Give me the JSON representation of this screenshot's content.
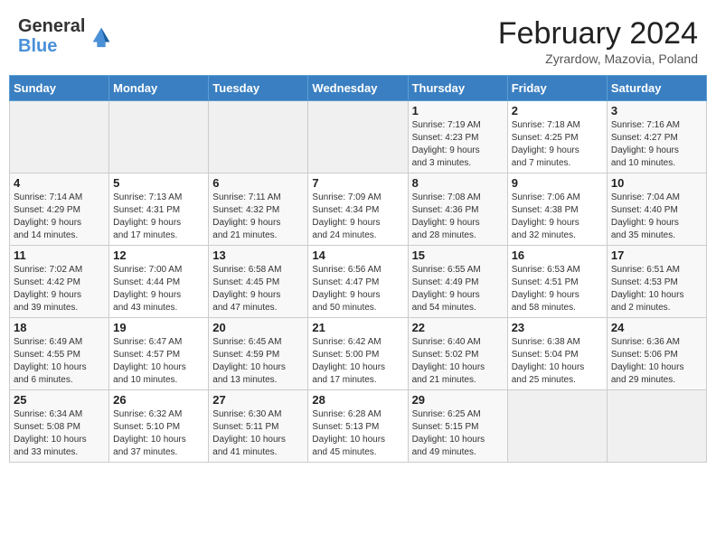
{
  "logo": {
    "general": "General",
    "blue": "Blue"
  },
  "title": {
    "month_year": "February 2024",
    "location": "Zyrardow, Mazovia, Poland"
  },
  "weekdays": [
    "Sunday",
    "Monday",
    "Tuesday",
    "Wednesday",
    "Thursday",
    "Friday",
    "Saturday"
  ],
  "weeks": [
    [
      {
        "day": "",
        "info": ""
      },
      {
        "day": "",
        "info": ""
      },
      {
        "day": "",
        "info": ""
      },
      {
        "day": "",
        "info": ""
      },
      {
        "day": "1",
        "info": "Sunrise: 7:19 AM\nSunset: 4:23 PM\nDaylight: 9 hours\nand 3 minutes."
      },
      {
        "day": "2",
        "info": "Sunrise: 7:18 AM\nSunset: 4:25 PM\nDaylight: 9 hours\nand 7 minutes."
      },
      {
        "day": "3",
        "info": "Sunrise: 7:16 AM\nSunset: 4:27 PM\nDaylight: 9 hours\nand 10 minutes."
      }
    ],
    [
      {
        "day": "4",
        "info": "Sunrise: 7:14 AM\nSunset: 4:29 PM\nDaylight: 9 hours\nand 14 minutes."
      },
      {
        "day": "5",
        "info": "Sunrise: 7:13 AM\nSunset: 4:31 PM\nDaylight: 9 hours\nand 17 minutes."
      },
      {
        "day": "6",
        "info": "Sunrise: 7:11 AM\nSunset: 4:32 PM\nDaylight: 9 hours\nand 21 minutes."
      },
      {
        "day": "7",
        "info": "Sunrise: 7:09 AM\nSunset: 4:34 PM\nDaylight: 9 hours\nand 24 minutes."
      },
      {
        "day": "8",
        "info": "Sunrise: 7:08 AM\nSunset: 4:36 PM\nDaylight: 9 hours\nand 28 minutes."
      },
      {
        "day": "9",
        "info": "Sunrise: 7:06 AM\nSunset: 4:38 PM\nDaylight: 9 hours\nand 32 minutes."
      },
      {
        "day": "10",
        "info": "Sunrise: 7:04 AM\nSunset: 4:40 PM\nDaylight: 9 hours\nand 35 minutes."
      }
    ],
    [
      {
        "day": "11",
        "info": "Sunrise: 7:02 AM\nSunset: 4:42 PM\nDaylight: 9 hours\nand 39 minutes."
      },
      {
        "day": "12",
        "info": "Sunrise: 7:00 AM\nSunset: 4:44 PM\nDaylight: 9 hours\nand 43 minutes."
      },
      {
        "day": "13",
        "info": "Sunrise: 6:58 AM\nSunset: 4:45 PM\nDaylight: 9 hours\nand 47 minutes."
      },
      {
        "day": "14",
        "info": "Sunrise: 6:56 AM\nSunset: 4:47 PM\nDaylight: 9 hours\nand 50 minutes."
      },
      {
        "day": "15",
        "info": "Sunrise: 6:55 AM\nSunset: 4:49 PM\nDaylight: 9 hours\nand 54 minutes."
      },
      {
        "day": "16",
        "info": "Sunrise: 6:53 AM\nSunset: 4:51 PM\nDaylight: 9 hours\nand 58 minutes."
      },
      {
        "day": "17",
        "info": "Sunrise: 6:51 AM\nSunset: 4:53 PM\nDaylight: 10 hours\nand 2 minutes."
      }
    ],
    [
      {
        "day": "18",
        "info": "Sunrise: 6:49 AM\nSunset: 4:55 PM\nDaylight: 10 hours\nand 6 minutes."
      },
      {
        "day": "19",
        "info": "Sunrise: 6:47 AM\nSunset: 4:57 PM\nDaylight: 10 hours\nand 10 minutes."
      },
      {
        "day": "20",
        "info": "Sunrise: 6:45 AM\nSunset: 4:59 PM\nDaylight: 10 hours\nand 13 minutes."
      },
      {
        "day": "21",
        "info": "Sunrise: 6:42 AM\nSunset: 5:00 PM\nDaylight: 10 hours\nand 17 minutes."
      },
      {
        "day": "22",
        "info": "Sunrise: 6:40 AM\nSunset: 5:02 PM\nDaylight: 10 hours\nand 21 minutes."
      },
      {
        "day": "23",
        "info": "Sunrise: 6:38 AM\nSunset: 5:04 PM\nDaylight: 10 hours\nand 25 minutes."
      },
      {
        "day": "24",
        "info": "Sunrise: 6:36 AM\nSunset: 5:06 PM\nDaylight: 10 hours\nand 29 minutes."
      }
    ],
    [
      {
        "day": "25",
        "info": "Sunrise: 6:34 AM\nSunset: 5:08 PM\nDaylight: 10 hours\nand 33 minutes."
      },
      {
        "day": "26",
        "info": "Sunrise: 6:32 AM\nSunset: 5:10 PM\nDaylight: 10 hours\nand 37 minutes."
      },
      {
        "day": "27",
        "info": "Sunrise: 6:30 AM\nSunset: 5:11 PM\nDaylight: 10 hours\nand 41 minutes."
      },
      {
        "day": "28",
        "info": "Sunrise: 6:28 AM\nSunset: 5:13 PM\nDaylight: 10 hours\nand 45 minutes."
      },
      {
        "day": "29",
        "info": "Sunrise: 6:25 AM\nSunset: 5:15 PM\nDaylight: 10 hours\nand 49 minutes."
      },
      {
        "day": "",
        "info": ""
      },
      {
        "day": "",
        "info": ""
      }
    ]
  ]
}
